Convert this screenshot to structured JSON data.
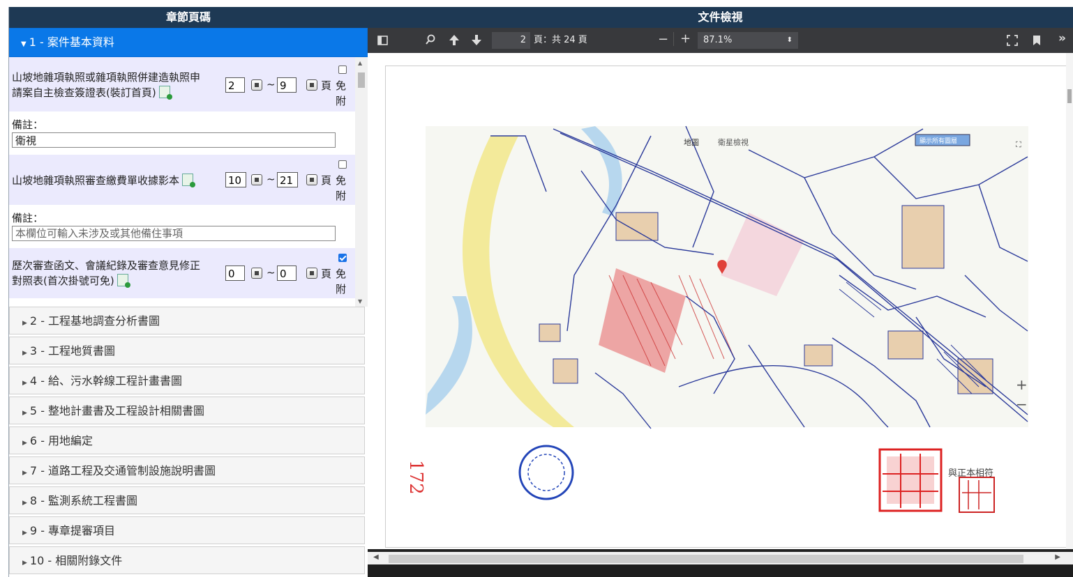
{
  "left_panel": {
    "header": "章節頁碼",
    "active_section": "1 - 案件基本資料",
    "items": [
      {
        "title_line1": "山坡地雜項執照或雜項執照併建造執照申",
        "title_line2": "請案自主檢查簽證表(裝訂首頁)",
        "page_from": "2",
        "page_to": "9",
        "page_label": "頁",
        "exempt_line1": "免",
        "exempt_line2": "附",
        "exempt_checked": false,
        "note_label": "備註：",
        "note_value": "衛視",
        "note_placeholder": ""
      },
      {
        "title_line1": "山坡地雜項執照審查繳費單收據影本",
        "title_line2": "",
        "page_from": "10",
        "page_to": "21",
        "page_label": "頁",
        "exempt_line1": "免",
        "exempt_line2": "附",
        "exempt_checked": false,
        "note_label": "備註：",
        "note_value": "",
        "note_placeholder": "本欄位可輸入未涉及或其他備住事項"
      },
      {
        "title_line1": "歷次審查函文、會議紀錄及審查意見修正",
        "title_line2": "對照表(首次掛號可免)",
        "page_from": "0",
        "page_to": "0",
        "page_label": "頁",
        "exempt_line1": "免",
        "exempt_line2": "附",
        "exempt_checked": true
      }
    ],
    "tilde": "~",
    "sections": [
      "2 - 工程基地調查分析書圖",
      "3 - 工程地質書圖",
      "4 - 給、污水幹線工程計畫書圖",
      "5 - 整地計畫書及工程設計相關書圖",
      "6 - 用地編定",
      "7 - 道路工程及交通管制設施說明書圖",
      "8 - 監測系統工程書圖",
      "9 - 專章提審項目",
      "10 - 相關附錄文件"
    ]
  },
  "right_panel": {
    "header": "文件檢視",
    "toolbar": {
      "page_current": "2",
      "page_total": "頁：共 24 頁",
      "zoom": "87.1%",
      "minus": "−",
      "plus": "+"
    },
    "map": {
      "tab_map": "地圖",
      "tab_satellite": "衛星檢視",
      "show_all_button": "顯示所有圖層",
      "zoom_in": "+",
      "zoom_out": "−",
      "stamp_text": "與正本相符",
      "handwritten": "172"
    }
  },
  "colors": {
    "header_bg": "#1e3954",
    "active_section_bg": "#0a78e8",
    "item_bg": "#ebeafd",
    "toolbar_bg": "#38393c",
    "map_line": "#2b3a9a",
    "map_red": "#e0403a"
  }
}
